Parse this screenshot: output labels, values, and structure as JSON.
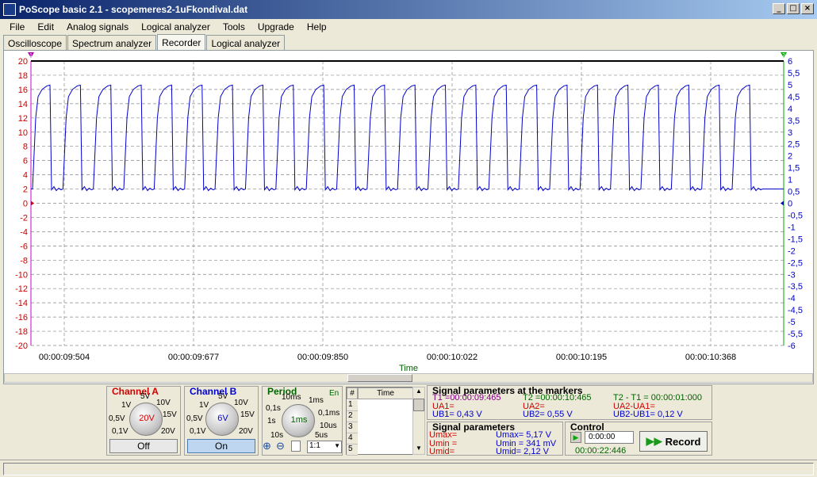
{
  "window": {
    "title": "PoScope basic 2.1 - scopemeres2-1uFkondival.dat"
  },
  "menu": [
    "File",
    "Edit",
    "Analog signals",
    "Logical analyzer",
    "Tools",
    "Upgrade",
    "Help"
  ],
  "tabs": [
    "Oscilloscope",
    "Spectrum analyzer",
    "Recorder",
    "Logical analyzer"
  ],
  "active_tab": "Recorder",
  "scope": {
    "left_ticks": [
      "20",
      "18",
      "16",
      "14",
      "12",
      "10",
      "8",
      "6",
      "4",
      "2",
      "0",
      "-2",
      "-4",
      "-6",
      "-8",
      "-10",
      "-12",
      "-14",
      "-16",
      "-18",
      "-20"
    ],
    "right_ticks": [
      "6",
      "5,5",
      "5",
      "4,5",
      "4",
      "3,5",
      "3",
      "2,5",
      "2",
      "1,5",
      "1",
      "0,5",
      "0",
      "-0,5",
      "-1",
      "-1,5",
      "-2",
      "-2,5",
      "-3",
      "-3,5",
      "-4",
      "-4,5",
      "-5",
      "-5,5",
      "-6"
    ],
    "time_labels": [
      "00:00:09:504",
      "00:00:09:677",
      "00:00:09:850",
      "00:00:10:022",
      "00:00:10:195",
      "00:00:10:368"
    ],
    "x_axis_label": "Time",
    "marker1_label": "1",
    "marker2_label": "2",
    "signal_color": "#0000cc",
    "left_axis_color": "#cc0000",
    "right_axis_color": "#006400",
    "signal_high": 16.5,
    "signal_low": 2.0,
    "pulse_count": 24
  },
  "channel_a": {
    "title": "Channel A",
    "value": "20V",
    "button": "Off",
    "ticks": [
      "5V",
      "1V",
      "10V",
      "0,5V",
      "15V",
      "0,1V",
      "20V"
    ]
  },
  "channel_b": {
    "title": "Channel B",
    "value": "6V",
    "button": "On",
    "ticks": [
      "5V",
      "1V",
      "10V",
      "0,5V",
      "15V",
      "0,1V",
      "20V"
    ]
  },
  "period": {
    "title": "Period",
    "value": "1ms",
    "en": "En",
    "ticks": [
      "10ms",
      "1ms",
      "0,1s",
      "0,1ms",
      "1s",
      "10us",
      "10s",
      "5us"
    ],
    "zoom": "1:1"
  },
  "marker_table": {
    "col_num": "#",
    "col_time": "Time",
    "rows": [
      "1",
      "2",
      "3",
      "4",
      "5"
    ]
  },
  "markers": {
    "title": "Signal parameters at the markers",
    "t1": "T1 =00:00:09:465",
    "ua1": "UA1=",
    "ub1": "UB1= 0,43 V",
    "t2": "T2 =00:00:10:465",
    "ua2": "UA2=",
    "ub2": "UB2= 0,55 V",
    "dt": "T2 - T1 = 00:00:01:000",
    "dua": "UA2-UA1=",
    "dub": "UB2-UB1= 0,12 V"
  },
  "signal_params": {
    "title": "Signal parameters",
    "umax_a": "Umax=",
    "umin_a": "Umin =",
    "umid_a": "Umid=",
    "umax_b": "Umax= 5,17 V",
    "umin_b": "Umin = 341 mV",
    "umid_b": "Umid=  2,12 V"
  },
  "control": {
    "title": "Control",
    "time_input": "0:00:00",
    "elapsed": "00:00:22:446",
    "record": "Record"
  }
}
